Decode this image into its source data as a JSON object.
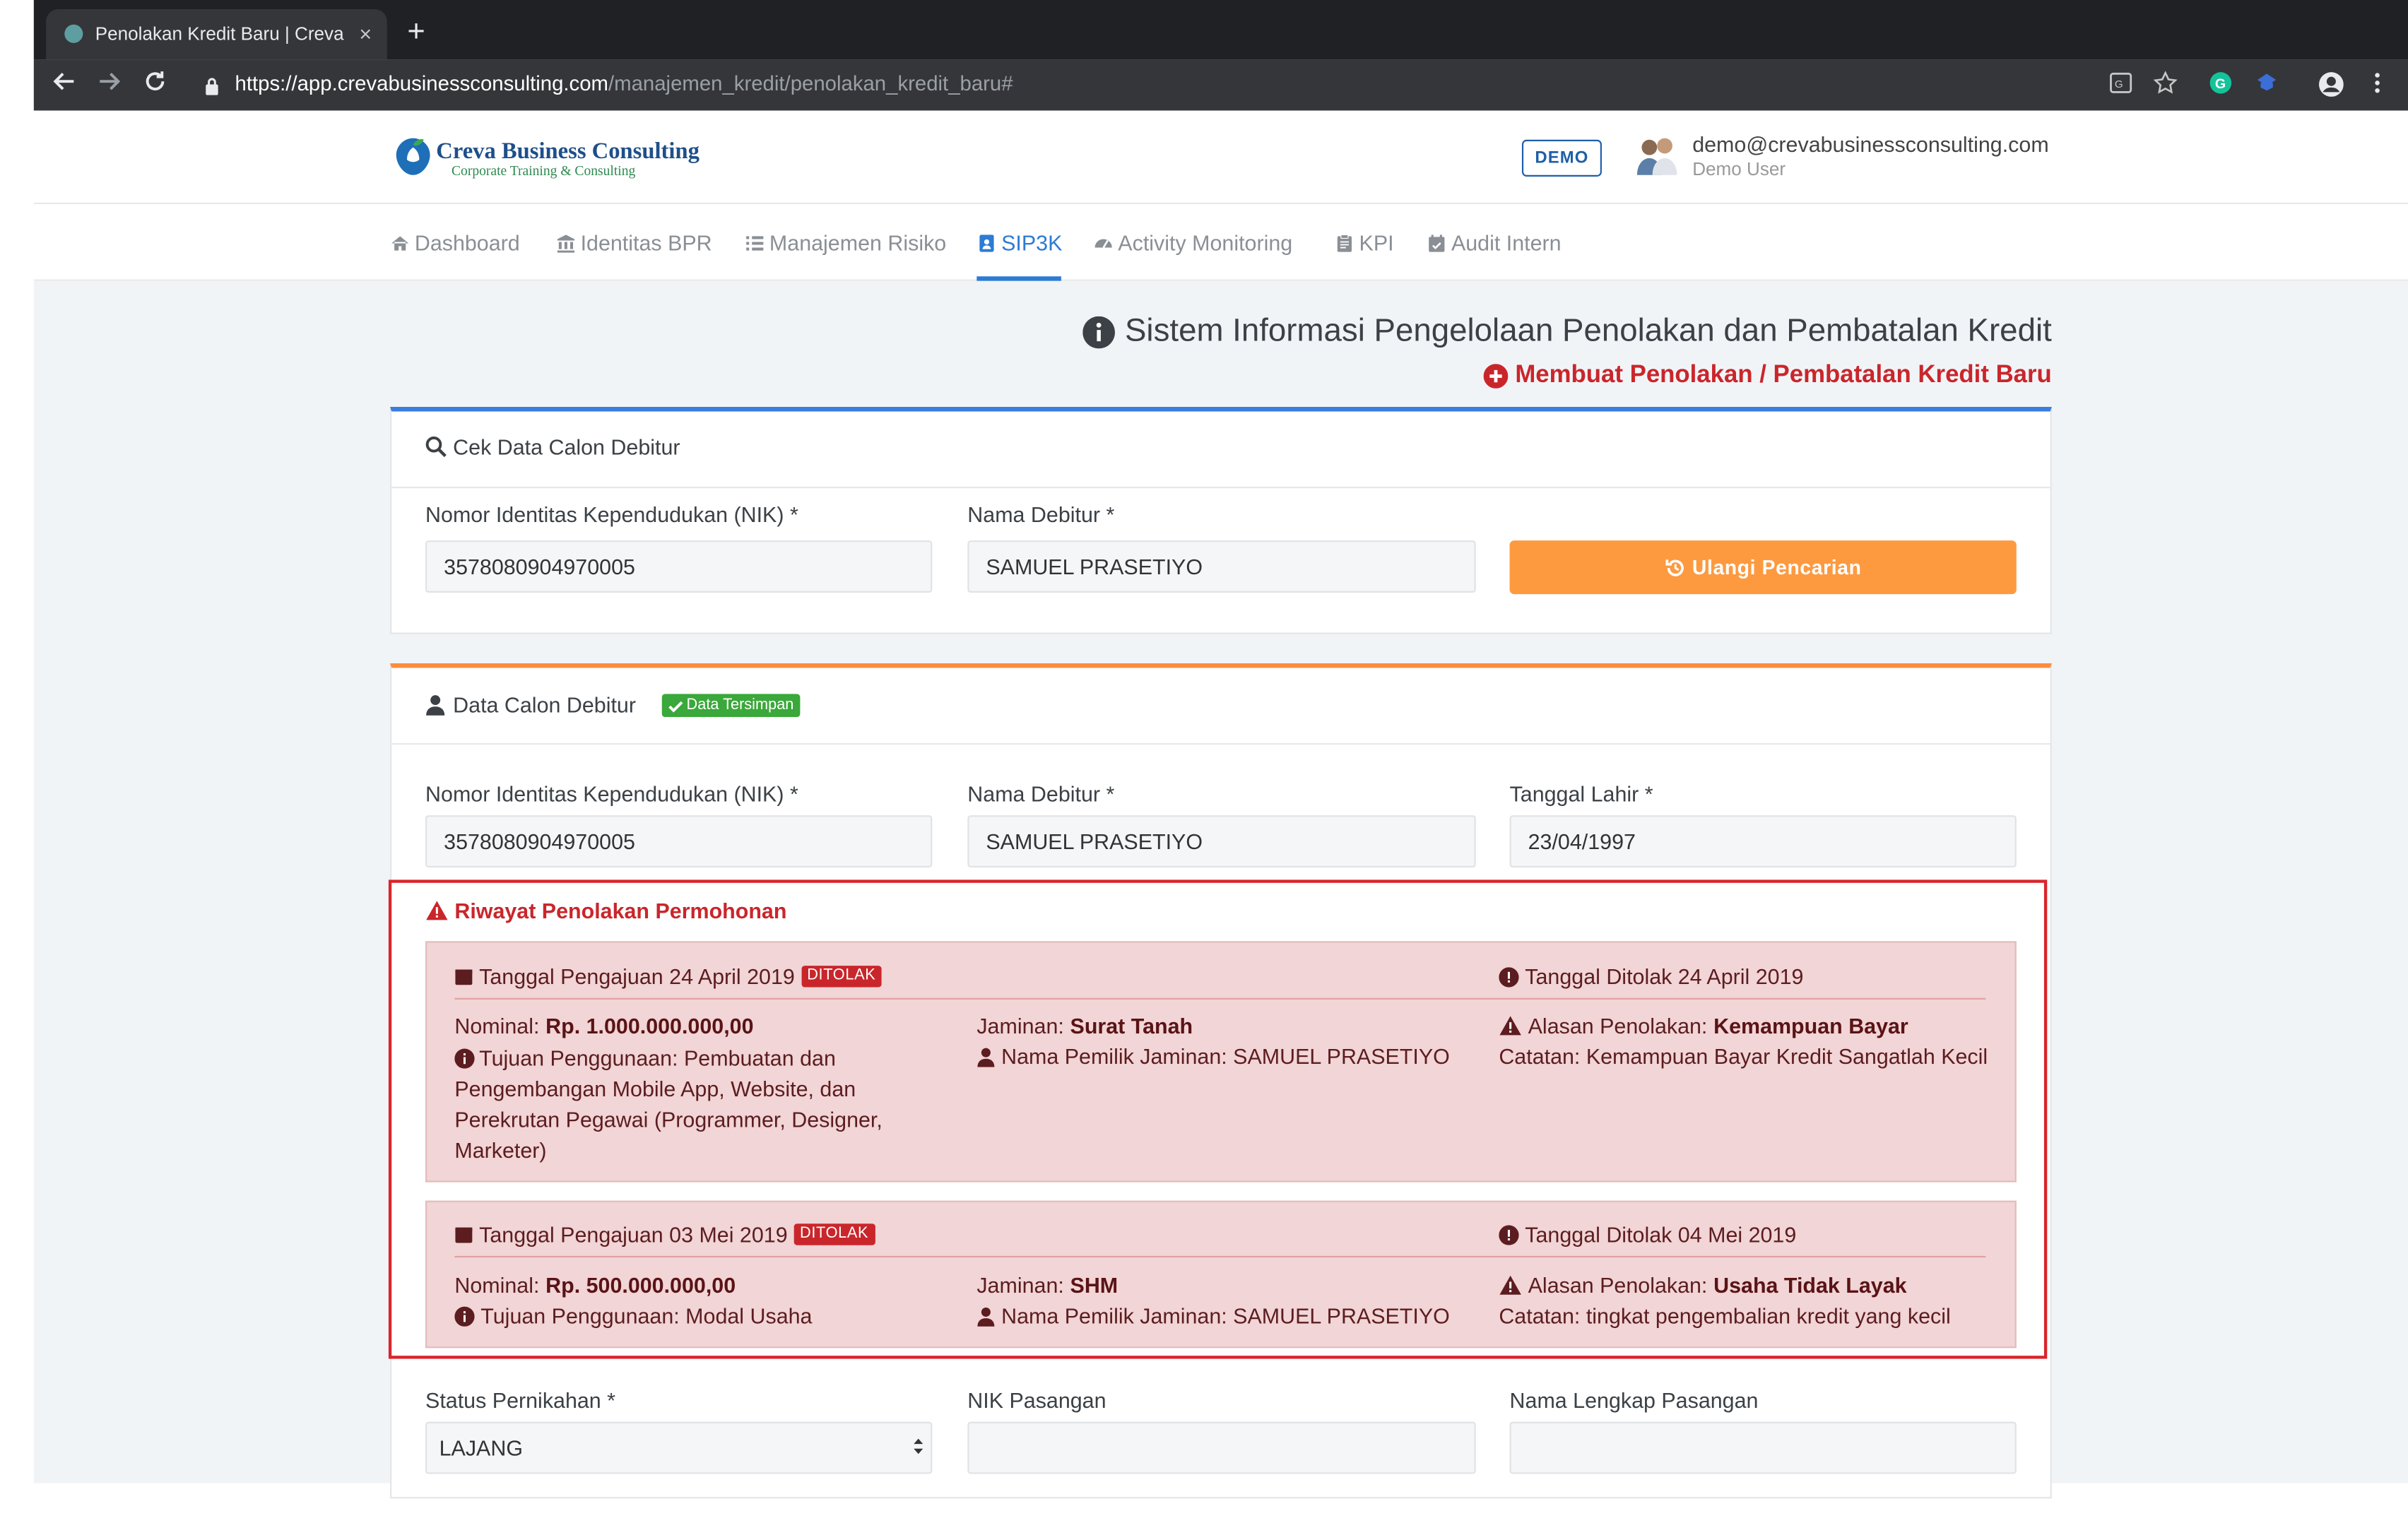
{
  "browser": {
    "tab_title": "Penolakan Kredit Baru | Creva Business Consulting",
    "tab_close": "×",
    "new_tab": "+",
    "url_host": "https://app.crevabusinessconsulting.com",
    "url_path": "/manajemen_kredit/penolakan_kredit_baru#"
  },
  "header": {
    "brand_name": "Creva Business Consulting",
    "brand_tagline": "Corporate Training & Consulting",
    "demo_badge": "DEMO",
    "user_email": "demo@crevabusinessconsulting.com",
    "user_role": "Demo User"
  },
  "nav": {
    "items": [
      {
        "label": "Dashboard",
        "icon": "home-icon"
      },
      {
        "label": "Identitas BPR",
        "icon": "bank-icon"
      },
      {
        "label": "Manajemen Risiko",
        "icon": "list-icon"
      },
      {
        "label": "SIP3K",
        "icon": "id-card-icon",
        "active": true
      },
      {
        "label": "Activity Monitoring",
        "icon": "gauge-icon"
      },
      {
        "label": "KPI",
        "icon": "clipboard-icon"
      },
      {
        "label": "Audit Intern",
        "icon": "calendar-check-icon"
      }
    ]
  },
  "page": {
    "title": "Sistem Informasi Pengelolaan Penolakan dan Pembatalan Kredit",
    "subtitle": "Membuat Penolakan / Pembatalan Kredit Baru"
  },
  "search_card": {
    "title": "Cek Data Calon Debitur",
    "nik_label": "Nomor Identitas Kependudukan (NIK) *",
    "nik_value": "3578080904970005",
    "name_label": "Nama Debitur *",
    "name_value": "SAMUEL PRASETIYO",
    "button_label": "Ulangi Pencarian"
  },
  "debtor_card": {
    "title": "Data Calon Debitur",
    "saved_badge": "Data Tersimpan",
    "nik_label": "Nomor Identitas Kependudukan (NIK) *",
    "nik_value": "3578080904970005",
    "name_label": "Nama Debitur *",
    "name_value": "SAMUEL PRASETIYO",
    "dob_label": "Tanggal Lahir *",
    "dob_value": "23/04/1997",
    "marital_label": "Status Pernikahan *",
    "marital_value": "LAJANG",
    "spouse_nik_label": "NIK Pasangan",
    "spouse_nik_value": "",
    "spouse_name_label": "Nama Lengkap Pasangan",
    "spouse_name_value": ""
  },
  "history": {
    "title": "Riwayat Penolakan Permohonan",
    "entries": [
      {
        "submitted": "Tanggal Pengajuan 24 April 2019",
        "status": "DITOLAK",
        "rejected": "Tanggal Ditolak 24 April 2019",
        "nominal_label": "Nominal:",
        "nominal_value": "Rp. 1.000.000.000,00",
        "purpose": "Tujuan Penggunaan: Pembuatan dan Pengembangan Mobile App, Website, dan Perekrutan Pegawai (Programmer, Designer, Marketer)",
        "collateral_label": "Jaminan:",
        "collateral_value": "Surat Tanah",
        "owner": "Nama Pemilik Jaminan: SAMUEL PRASETIYO",
        "reason_label": "Alasan Penolakan:",
        "reason_value": "Kemampuan Bayar",
        "note": "Catatan: Kemampuan Bayar Kredit Sangatlah Kecil"
      },
      {
        "submitted": "Tanggal Pengajuan 03 Mei 2019",
        "status": "DITOLAK",
        "rejected": "Tanggal Ditolak 04 Mei 2019",
        "nominal_label": "Nominal:",
        "nominal_value": "Rp. 500.000.000,00",
        "purpose": "Tujuan Penggunaan: Modal Usaha",
        "collateral_label": "Jaminan:",
        "collateral_value": "SHM",
        "owner": "Nama Pemilik Jaminan: SAMUEL PRASETIYO",
        "reason_label": "Alasan Penolakan:",
        "reason_value": "Usaha Tidak Layak",
        "note": "Catatan: tingkat pengembalian kredit yang kecil"
      }
    ]
  },
  "colors": {
    "primary": "#2d7bd4",
    "danger": "#c9262b",
    "orange": "#fd9a40",
    "success": "#3aa83a"
  }
}
